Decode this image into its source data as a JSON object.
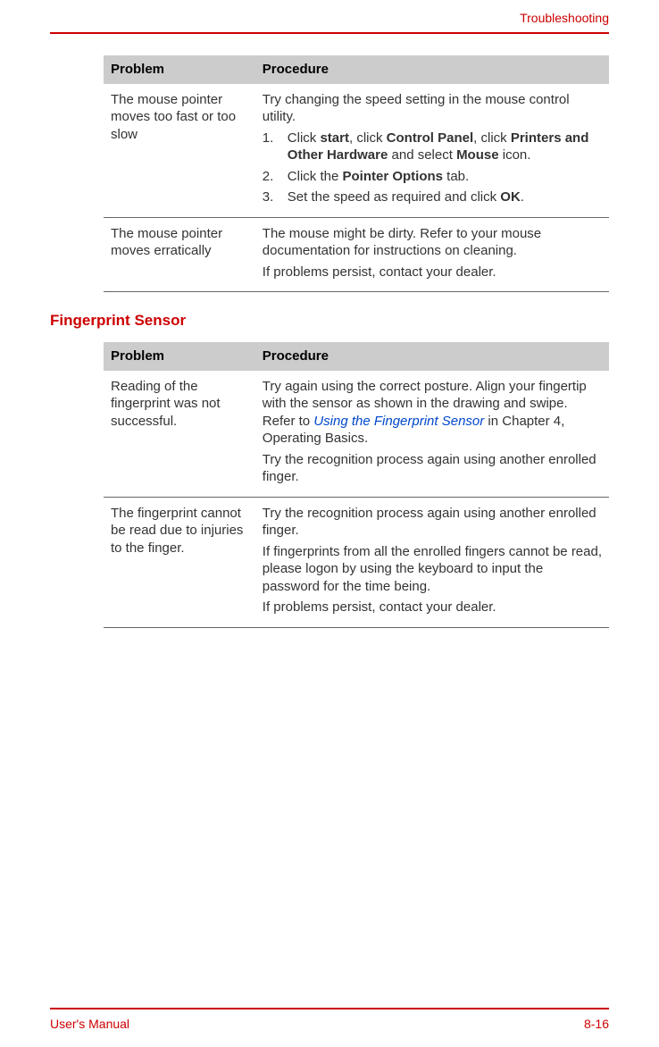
{
  "header": {
    "chapter": "Troubleshooting"
  },
  "table1": {
    "columns": {
      "problem": "Problem",
      "procedure": "Procedure"
    },
    "rows": [
      {
        "problem": "The mouse pointer moves too fast or too slow",
        "intro": "Try changing the speed setting in the mouse control utility.",
        "step1_pre": "Click ",
        "step1_b1": "start",
        "step1_mid1": ", click ",
        "step1_b2": "Control Panel",
        "step1_mid2": ", click ",
        "step1_b3": "Printers and Other Hardware",
        "step1_mid3": " and select ",
        "step1_b4": "Mouse",
        "step1_end": " icon.",
        "step2_pre": "Click the ",
        "step2_b1": "Pointer Options",
        "step2_end": " tab.",
        "step3_pre": "Set the speed as required and click ",
        "step3_b1": "OK",
        "step3_end": "."
      },
      {
        "problem": "The mouse pointer moves erratically",
        "p1": "The mouse might be dirty. Refer to your mouse documentation for instructions on cleaning.",
        "p2": "If problems persist, contact your dealer."
      }
    ]
  },
  "section2_heading": "Fingerprint Sensor",
  "table2": {
    "columns": {
      "problem": "Problem",
      "procedure": "Procedure"
    },
    "rows": [
      {
        "problem": "Reading of the fingerprint was not successful.",
        "p1_pre": "Try again using the correct posture. Align your fingertip with the sensor as shown in the drawing and swipe. Refer to ",
        "p1_link": "Using the Fingerprint Sensor",
        "p1_post": " in Chapter 4, Operating Basics.",
        "p2": "Try the recognition process again using another enrolled finger."
      },
      {
        "problem": "The fingerprint cannot be read due to injuries to the finger.",
        "p1": "Try the recognition process again using another enrolled finger.",
        "p2": "If fingerprints from all the enrolled fingers cannot be read, please logon by using the keyboard to input the password for the time being.",
        "p3": "If problems persist, contact your dealer."
      }
    ]
  },
  "footer": {
    "left": "User's Manual",
    "right": "8-16"
  }
}
